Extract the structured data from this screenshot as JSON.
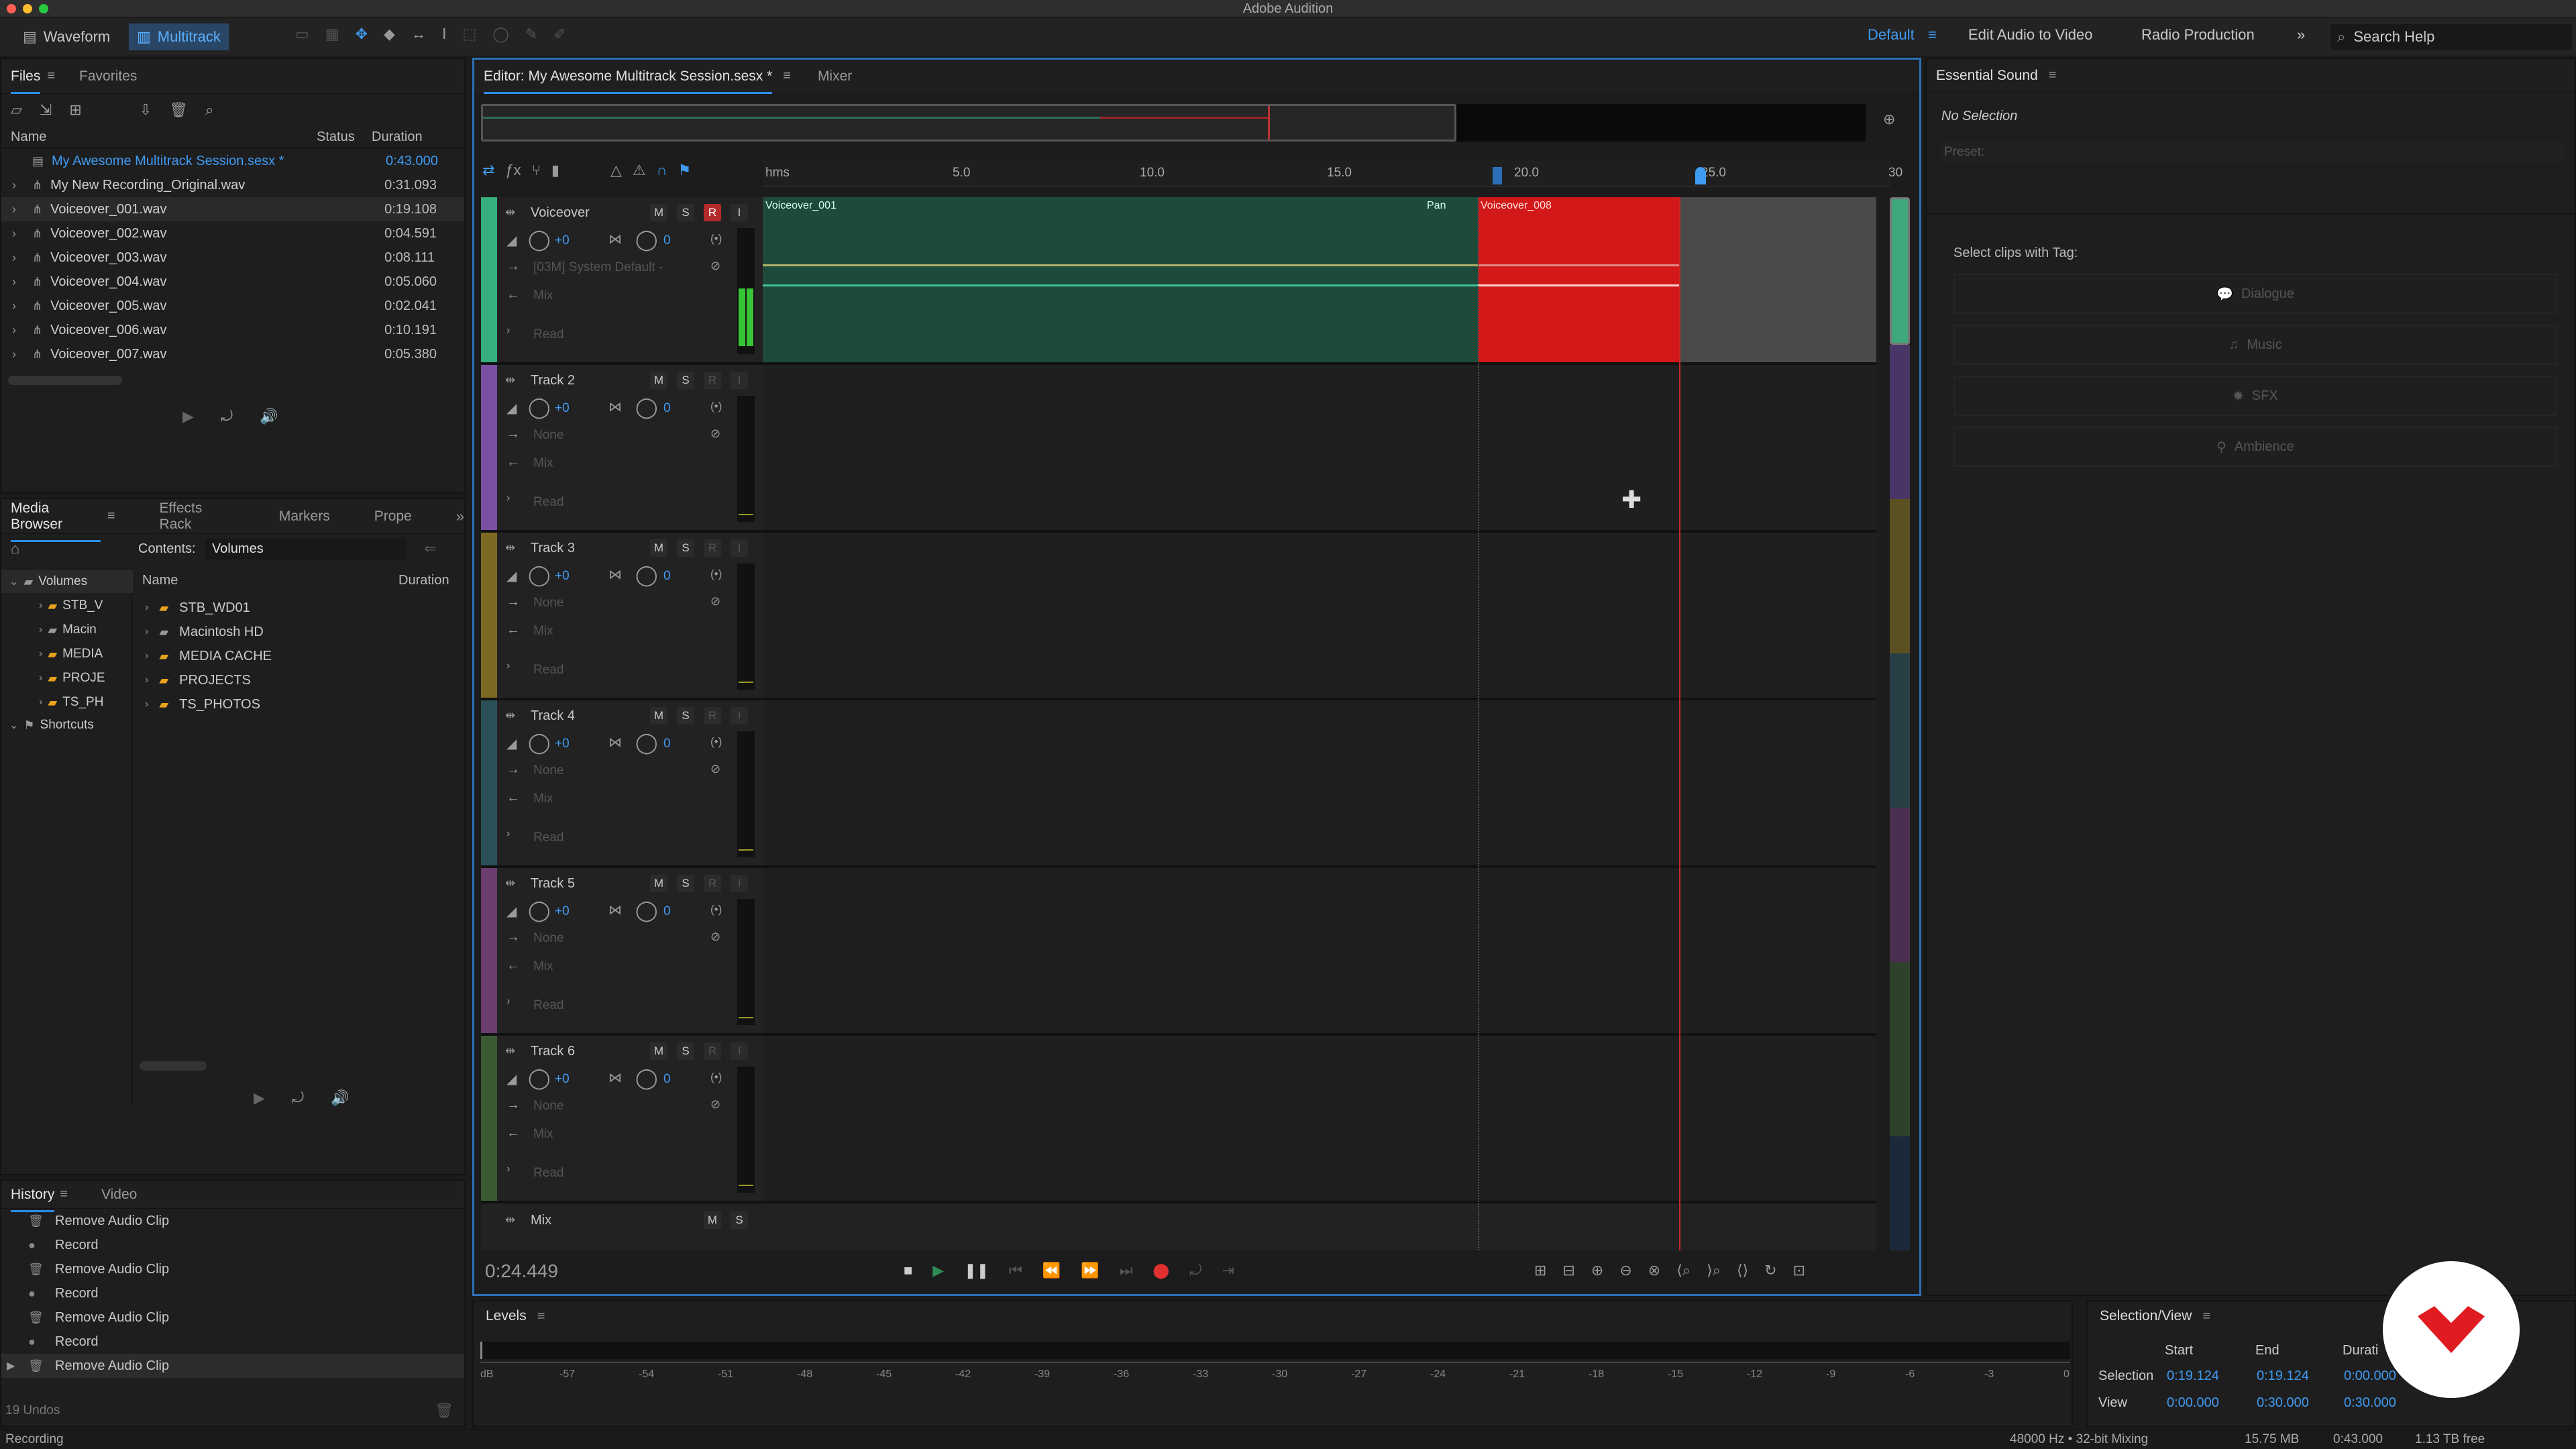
{
  "app_title": "Adobe Audition",
  "modes": {
    "waveform": "Waveform",
    "multitrack": "Multitrack"
  },
  "workspaces": {
    "default": "Default",
    "edit_video": "Edit Audio to Video",
    "radio": "Radio Production",
    "search": "Search Help"
  },
  "files": {
    "tabs": [
      "Files",
      "Favorites"
    ],
    "headers": {
      "name": "Name",
      "status": "Status",
      "duration": "Duration"
    },
    "rows": [
      {
        "name": "My Awesome Multitrack Session.sesx *",
        "duration": "0:43.000"
      },
      {
        "name": "My New Recording_Original.wav",
        "duration": "0:31.093"
      },
      {
        "name": "Voiceover_001.wav",
        "duration": "0:19.108"
      },
      {
        "name": "Voiceover_002.wav",
        "duration": "0:04.591"
      },
      {
        "name": "Voiceover_003.wav",
        "duration": "0:08.111"
      },
      {
        "name": "Voiceover_004.wav",
        "duration": "0:05.060"
      },
      {
        "name": "Voiceover_005.wav",
        "duration": "0:02.041"
      },
      {
        "name": "Voiceover_006.wav",
        "duration": "0:10.191"
      },
      {
        "name": "Voiceover_007.wav",
        "duration": "0:05.380"
      }
    ]
  },
  "media": {
    "tabs": [
      "Media Browser",
      "Effects Rack",
      "Markers",
      "Prope"
    ],
    "contents_label": "Contents:",
    "contents_value": "Volumes",
    "headers": {
      "name": "Name",
      "duration": "Duration"
    },
    "tree": [
      {
        "label": "Volumes"
      },
      {
        "label": "STB_V"
      },
      {
        "label": "Macin"
      },
      {
        "label": "MEDIA"
      },
      {
        "label": "PROJE"
      },
      {
        "label": "TS_PH"
      },
      {
        "label": "Shortcuts"
      }
    ],
    "items": [
      "STB_WD01",
      "Macintosh HD",
      "MEDIA CACHE",
      "PROJECTS",
      "TS_PHOTOS"
    ]
  },
  "history": {
    "tabs": [
      "History",
      "Video"
    ],
    "items": [
      "Remove Audio Clip",
      "Record",
      "Remove Audio Clip",
      "Record",
      "Remove Audio Clip",
      "Record",
      "Remove Audio Clip"
    ],
    "undos": "19 Undos"
  },
  "editor": {
    "tabs": [
      "Editor: My Awesome Multitrack Session.sesx *",
      "Mixer"
    ],
    "ruler": [
      "hms",
      "5.0",
      "10.0",
      "15.0",
      "20.0",
      "25.0",
      "30"
    ],
    "time": "0:24.449",
    "tracks": [
      {
        "name": "Voiceover",
        "vol": "+0",
        "pan": "0",
        "input": "[03M] System Default -",
        "out": "Mix",
        "mode": "Read",
        "color": "#36b07f"
      },
      {
        "name": "Track 2",
        "vol": "+0",
        "pan": "0",
        "input": "None",
        "out": "Mix",
        "mode": "Read",
        "color": "#7b4fa3"
      },
      {
        "name": "Track 3",
        "vol": "+0",
        "pan": "0",
        "input": "None",
        "out": "Mix",
        "mode": "Read",
        "color": "#7d6a22"
      },
      {
        "name": "Track 4",
        "vol": "+0",
        "pan": "0",
        "input": "None",
        "out": "Mix",
        "mode": "Read",
        "color": "#2c5057"
      },
      {
        "name": "Track 5",
        "vol": "+0",
        "pan": "0",
        "input": "None",
        "out": "Mix",
        "mode": "Read",
        "color": "#6a3c6f"
      },
      {
        "name": "Track 6",
        "vol": "+0",
        "pan": "0",
        "input": "None",
        "out": "Mix",
        "mode": "Read",
        "color": "#3b5a33"
      }
    ],
    "mix_track": "Mix",
    "clip1": "Voiceover_001",
    "clip2": "Voiceover_008",
    "pan_label": "Pan",
    "btn_m": "M",
    "btn_s": "S",
    "btn_r": "R",
    "btn_i": "I"
  },
  "essential": {
    "title": "Essential Sound",
    "nosel": "No Selection",
    "preset": "Preset:",
    "tag_label": "Select clips with Tag:",
    "tags": [
      "Dialogue",
      "Music",
      "SFX",
      "Ambience"
    ]
  },
  "levels": {
    "title": "Levels",
    "scale": [
      "dB",
      "-57",
      "-54",
      "-51",
      "-48",
      "-45",
      "-42",
      "-39",
      "-36",
      "-33",
      "-30",
      "-27",
      "-24",
      "-21",
      "-18",
      "-15",
      "-12",
      "-9",
      "-6",
      "-3",
      "0"
    ]
  },
  "selview": {
    "title": "Selection/View",
    "start": "Start",
    "end": "End",
    "dur": "Durati",
    "sel_label": "Selection",
    "view_label": "View",
    "sel_start": "0:19.124",
    "sel_end": "0:19.124",
    "sel_dur": "0:00.000",
    "view_start": "0:00.000",
    "view_end": "0:30.000",
    "view_dur": "0:30.000"
  },
  "status": {
    "left": "Recording",
    "rate": "48000 Hz • 32-bit Mixing",
    "mem": "15.75 MB",
    "dur": "0:43.000",
    "free": "1.13 TB free"
  }
}
